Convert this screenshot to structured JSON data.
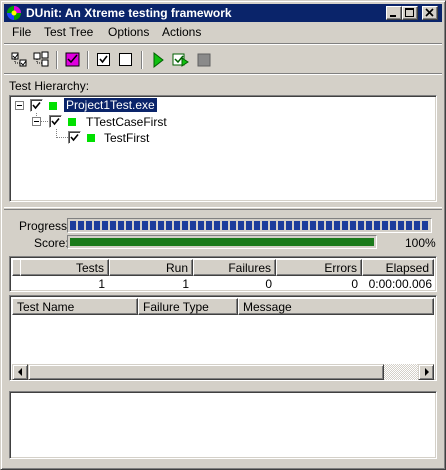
{
  "window": {
    "title": "DUnit: An Xtreme testing framework"
  },
  "menu": [
    {
      "label": "File"
    },
    {
      "label": "Test Tree"
    },
    {
      "label": "Options"
    },
    {
      "label": "Actions"
    }
  ],
  "toolbar": {
    "icons": [
      "select-all-icon",
      "deselect-all-icon",
      "select-failed-icon",
      "check-icon",
      "uncheck-icon",
      "run-icon",
      "run-selected-icon",
      "stop-icon"
    ]
  },
  "hierarchy": {
    "label": "Test Hierarchy:",
    "nodes": [
      {
        "label": "Project1Test.exe",
        "checked": true,
        "status": "passed",
        "selected": true
      },
      {
        "label": "TTestCaseFirst",
        "checked": true,
        "status": "passed",
        "selected": false
      },
      {
        "label": "TestFirst",
        "checked": true,
        "status": "passed",
        "selected": false
      }
    ]
  },
  "progress": {
    "progress_label": "Progress:",
    "score_label": "Score:",
    "progress_fraction": 1.0,
    "score_fraction": 1.0,
    "score_percent": "100%",
    "colors": {
      "progress": "#1c3d9c",
      "score": "#1a7a1a",
      "passed": "#00e000"
    }
  },
  "stats": {
    "headers": [
      "Tests",
      "Run",
      "Failures",
      "Errors",
      "Elapsed"
    ],
    "values": [
      "1",
      "1",
      "0",
      "0",
      "0:00:00.006"
    ]
  },
  "failures": {
    "headers": [
      "Test Name",
      "Failure Type",
      "Message"
    ]
  }
}
